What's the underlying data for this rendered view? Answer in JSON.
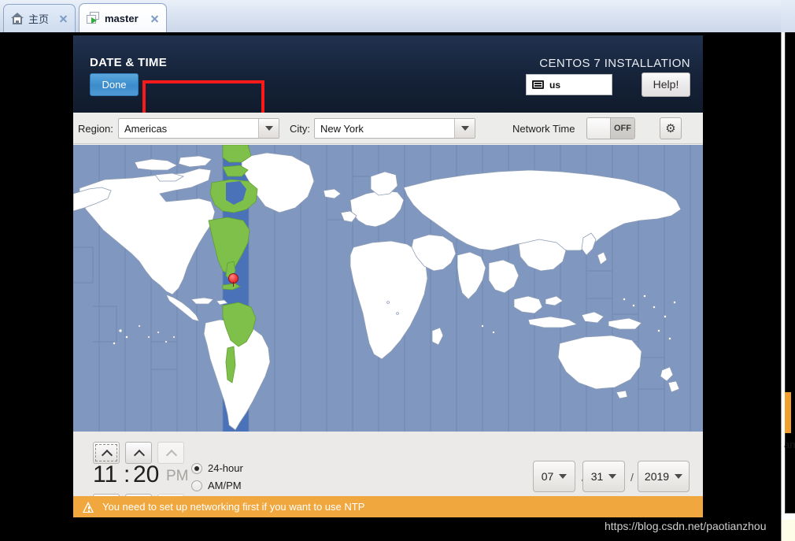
{
  "browser": {
    "tabs": [
      {
        "label": "主页",
        "icon": "home-icon",
        "active": false,
        "close": "×"
      },
      {
        "label": "master",
        "icon": "vm-window-icon",
        "active": true,
        "close": "×"
      }
    ]
  },
  "installer": {
    "header": {
      "screen_title": "DATE & TIME",
      "done_label": "Done",
      "product_title": "CENTOS 7 INSTALLATION",
      "keyboard_layout": "us",
      "keyboard_icon": "keyboard-icon",
      "help_label": "Help!"
    },
    "toolbar": {
      "region_label": "Region:",
      "region_value": "Americas",
      "city_label": "City:",
      "city_value": "New York",
      "network_time_label": "Network Time",
      "network_time_state": "OFF",
      "settings_icon": "gear-icon"
    },
    "map": {
      "selected_city_marker": "map-pin-icon",
      "ocean_color": "#8098c0",
      "land_color": "#ffffff",
      "highlight_color": "#7ec04a",
      "selected_band_color": "#4a72b8"
    },
    "time": {
      "hour": "11",
      "separator": ":",
      "minute": "20",
      "ampm": "PM",
      "format_options": [
        {
          "label": "24-hour",
          "selected": true
        },
        {
          "label": "AM/PM",
          "selected": false
        }
      ],
      "spinner_up_icon": "chevron-up-icon",
      "spinner_down_icon": "chevron-down-icon"
    },
    "date": {
      "month": "07",
      "day": "31",
      "year": "2019",
      "separator": "/",
      "dropdown_icon": "caret-down-icon"
    },
    "warning": {
      "icon": "warning-triangle-icon",
      "text": "You need to set up networking first if you want to use NTP"
    },
    "accent_colors": {
      "header_bg": "#18263f",
      "done_button": "#3f90cf",
      "highlight_box": "#fb1a1a",
      "warning_bg": "#f0a73e"
    }
  },
  "watermark": {
    "text": "https://blog.csdn.net/paotianzhou"
  },
  "background_window": {
    "partial_text": "an"
  }
}
